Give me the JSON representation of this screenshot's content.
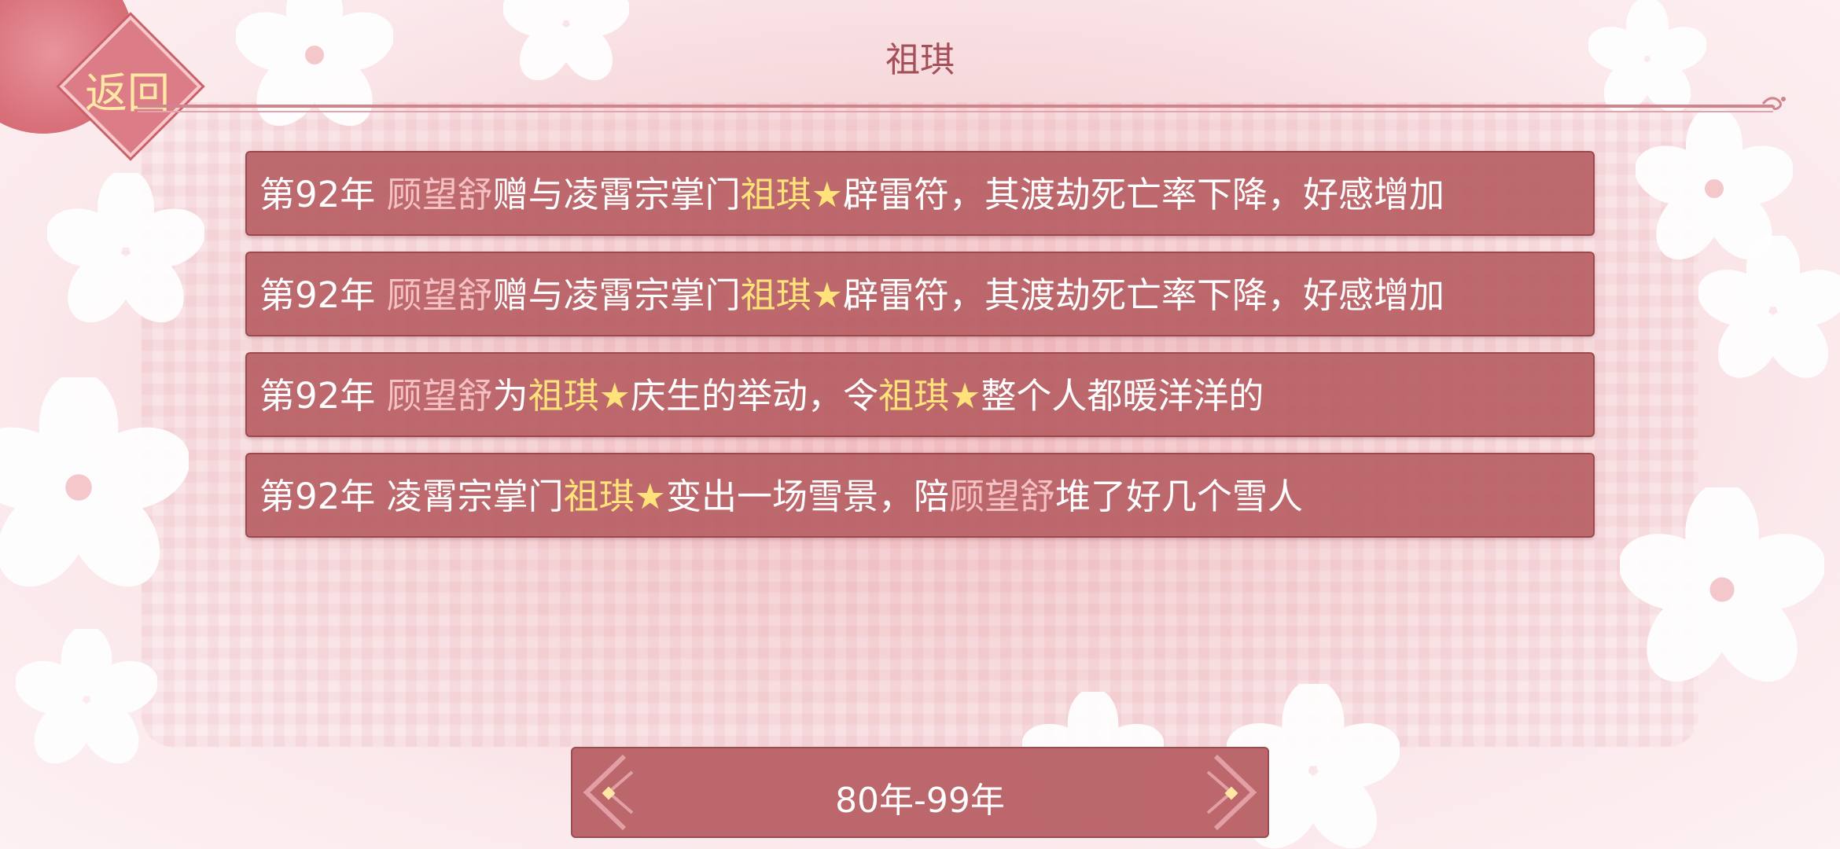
{
  "header": {
    "back_label": "返回",
    "title": "祖琪"
  },
  "events": [
    {
      "segments": [
        {
          "text": "第92年 ",
          "style": "plain"
        },
        {
          "text": "顾望舒",
          "style": "name"
        },
        {
          "text": "赠与凌霄宗掌门",
          "style": "plain"
        },
        {
          "text": "祖琪",
          "style": "hl"
        },
        {
          "text": "★",
          "style": "hl"
        },
        {
          "text": "辟雷符，其渡劫死亡率下降，好感增加",
          "style": "plain"
        }
      ]
    },
    {
      "segments": [
        {
          "text": "第92年 ",
          "style": "plain"
        },
        {
          "text": "顾望舒",
          "style": "name"
        },
        {
          "text": "赠与凌霄宗掌门",
          "style": "plain"
        },
        {
          "text": "祖琪",
          "style": "hl"
        },
        {
          "text": "★",
          "style": "hl"
        },
        {
          "text": "辟雷符，其渡劫死亡率下降，好感增加",
          "style": "plain"
        }
      ]
    },
    {
      "segments": [
        {
          "text": "第92年 ",
          "style": "plain"
        },
        {
          "text": "顾望舒",
          "style": "name"
        },
        {
          "text": "为",
          "style": "plain"
        },
        {
          "text": "祖琪",
          "style": "hl"
        },
        {
          "text": "★",
          "style": "hl"
        },
        {
          "text": "庆生的举动，令",
          "style": "plain"
        },
        {
          "text": "祖琪",
          "style": "hl"
        },
        {
          "text": "★",
          "style": "hl"
        },
        {
          "text": "整个人都暖洋洋的",
          "style": "plain"
        }
      ]
    },
    {
      "segments": [
        {
          "text": "第92年 凌霄宗掌门",
          "style": "plain"
        },
        {
          "text": "祖琪",
          "style": "hl"
        },
        {
          "text": "★",
          "style": "hl"
        },
        {
          "text": "变出一场雪景，陪",
          "style": "plain"
        },
        {
          "text": "顾望舒",
          "style": "name"
        },
        {
          "text": "堆了好几个雪人",
          "style": "plain"
        }
      ]
    }
  ],
  "pager": {
    "range_label": "80年-99年"
  },
  "colors": {
    "panel": "#b76064",
    "name_text": "#f6c1c4",
    "highlight_text": "#ffe27a",
    "title_text": "#a55058"
  }
}
